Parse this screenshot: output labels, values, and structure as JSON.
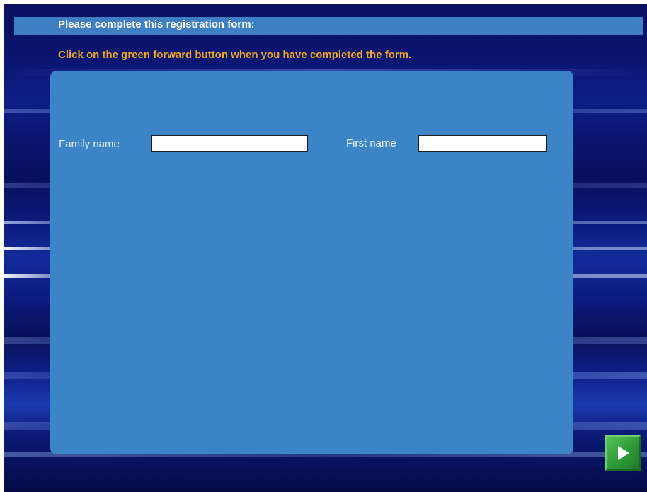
{
  "header": {
    "title": "Please complete this registration form:"
  },
  "instruction": "Click on the green forward button when you have completed the form.",
  "form": {
    "family_name": {
      "label": "Family name",
      "value": ""
    },
    "first_name": {
      "label": "First name",
      "value": ""
    }
  },
  "navigation": {
    "forward_icon": "play-arrow-icon"
  },
  "colors": {
    "title_bar": "#3e7fc4",
    "instruction_text": "#f0a81c",
    "form_panel": "#3b84c8",
    "forward_button": "#2e9a35"
  }
}
